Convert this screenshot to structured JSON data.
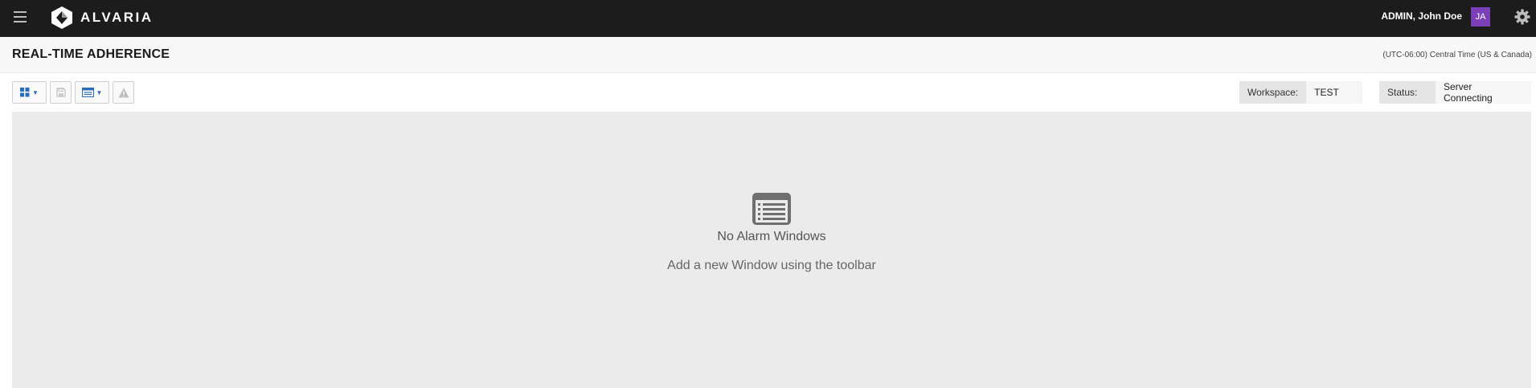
{
  "topbar": {
    "brand": "ALVARIA",
    "user_name": "ADMIN, John Doe",
    "avatar_initials": "JA",
    "avatar_color": "#7b3fb8",
    "icons": [
      "hamburger-menu-icon",
      "alvaria-logo",
      "gear-icon"
    ]
  },
  "page_header": {
    "title": "REAL-TIME ADHERENCE",
    "timezone": "(UTC-06:00) Central Time (US & Canada)"
  },
  "toolbar": {
    "buttons": [
      {
        "icon": "layout-grid-icon",
        "has_dropdown": true,
        "enabled": true
      },
      {
        "icon": "save-icon",
        "has_dropdown": false,
        "enabled": false
      },
      {
        "icon": "window-icon",
        "has_dropdown": true,
        "enabled": true
      },
      {
        "icon": "warning-icon",
        "has_dropdown": false,
        "enabled": false
      }
    ],
    "workspace_label": "Workspace:",
    "workspace_value": "TEST",
    "status_label": "Status:",
    "status_value": "Server Connecting",
    "accent_color": "#2a6ebb"
  },
  "empty_state": {
    "icon": "list-window-icon",
    "title": "No Alarm Windows",
    "subtitle": "Add a new Window using the toolbar"
  }
}
